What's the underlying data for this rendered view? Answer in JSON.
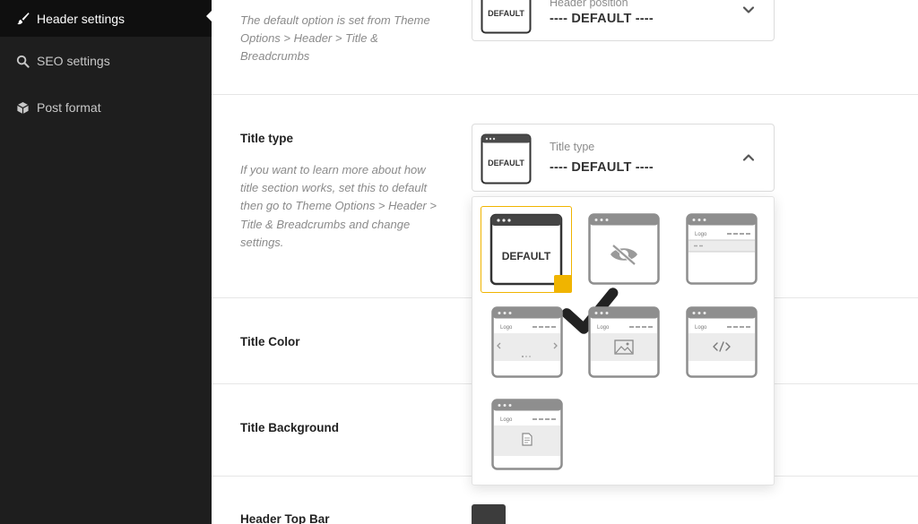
{
  "sidebar": {
    "items": [
      {
        "label": "Header settings",
        "icon": "brush-icon",
        "active": true
      },
      {
        "label": "SEO settings",
        "icon": "search-icon",
        "active": false
      },
      {
        "label": "Post format",
        "icon": "cube-icon",
        "active": false
      }
    ]
  },
  "header_position_row": {
    "description": "The default option is set from Theme Options > Header > Title & Breadcrumbs",
    "select_label": "Header position",
    "select_value": "---- DEFAULT ----",
    "thumb_text": "DEFAULT"
  },
  "title_type_row": {
    "title": "Title type",
    "description": "If you want to learn more about how title section works, set this to default then go to Theme Options > Header > Title & Breadcrumbs and change settings.",
    "select_label": "Title type",
    "select_value": "---- DEFAULT ----",
    "thumb_text": "DEFAULT"
  },
  "title_type_options": [
    {
      "name": "default",
      "text": "DEFAULT",
      "selected": true
    },
    {
      "name": "hidden",
      "icon": "eye-slash-icon"
    },
    {
      "name": "logo-menu-bar",
      "logo": "Logo"
    },
    {
      "name": "slider",
      "logo": "Logo"
    },
    {
      "name": "image",
      "logo": "Logo",
      "icon": "image-icon"
    },
    {
      "name": "code",
      "logo": "Logo",
      "icon": "code-icon"
    },
    {
      "name": "page-content",
      "logo": "Logo",
      "icon": "document-icon"
    }
  ],
  "title_color_row": {
    "title": "Title Color"
  },
  "title_background_row": {
    "title": "Title Background"
  },
  "header_top_bar_row": {
    "title": "Header Top Bar"
  },
  "colors": {
    "sidebar_bg": "#1e1e1e",
    "sidebar_active_bg": "#0f0f0f",
    "accent": "#f0b400"
  }
}
